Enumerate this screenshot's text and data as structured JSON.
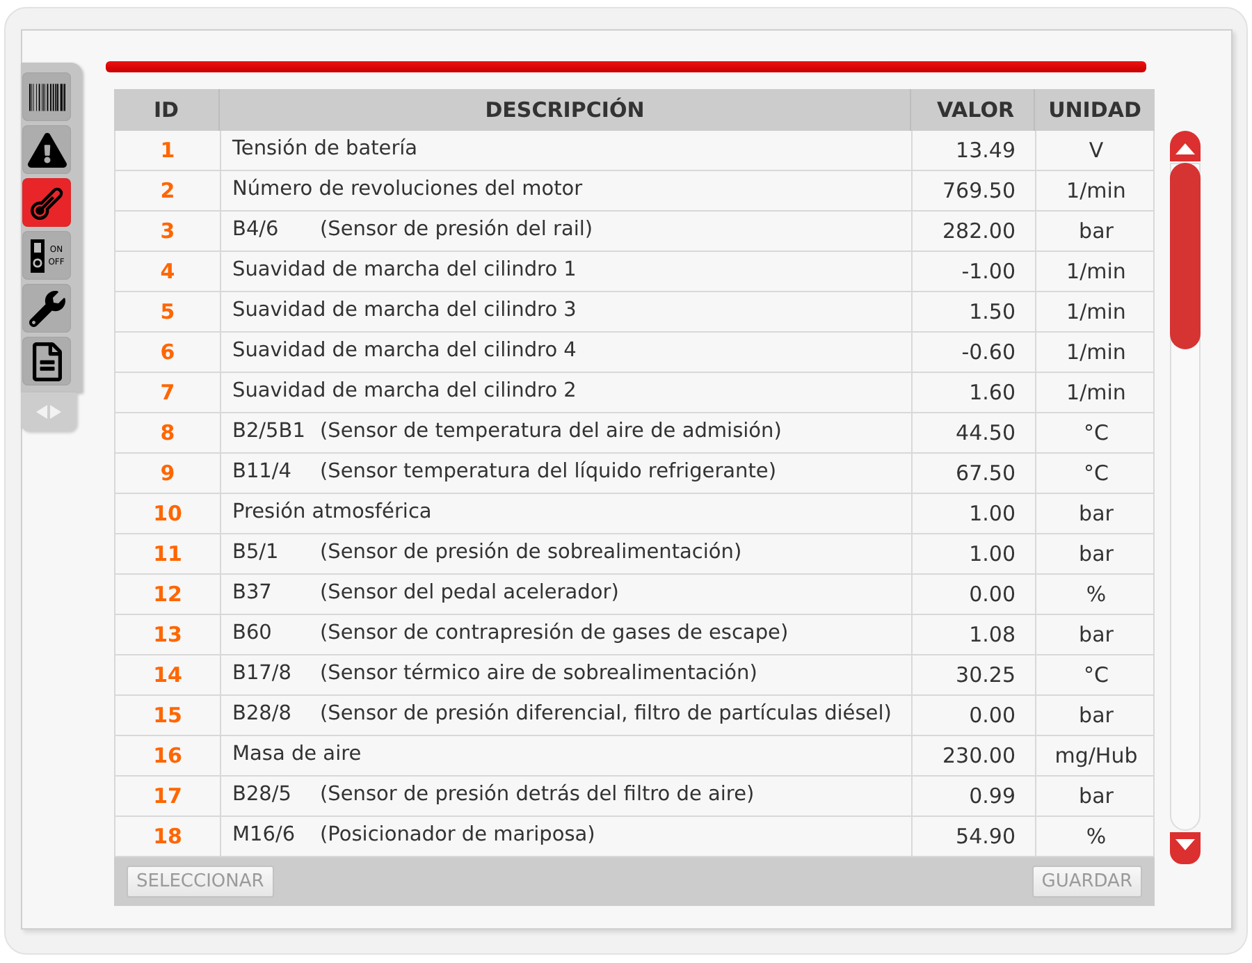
{
  "sidebar": {
    "items": [
      {
        "selected": false
      },
      {
        "selected": false
      },
      {
        "selected": true
      },
      {
        "selected": false,
        "labels": [
          "ON",
          "OFF"
        ]
      },
      {
        "selected": false
      },
      {
        "selected": false
      }
    ]
  },
  "table": {
    "columns": [
      "ID",
      "DESCRIPCIÓN",
      "VALOR",
      "UNIDAD"
    ],
    "rows": [
      {
        "id": "1",
        "description": "Tensión de batería",
        "value": "13.49",
        "unit": "V"
      },
      {
        "id": "2",
        "description": "Número de revoluciones del motor",
        "value": "769.50",
        "unit": "1/min"
      },
      {
        "id": "3",
        "code": "B4/6",
        "description": "(Sensor de presión del rail)",
        "value": "282.00",
        "unit": "bar"
      },
      {
        "id": "4",
        "description": "Suavidad de marcha del cilindro 1",
        "value": "-1.00",
        "unit": "1/min"
      },
      {
        "id": "5",
        "description": "Suavidad de marcha del cilindro 3",
        "value": "1.50",
        "unit": "1/min"
      },
      {
        "id": "6",
        "description": "Suavidad de marcha del cilindro 4",
        "value": "-0.60",
        "unit": "1/min"
      },
      {
        "id": "7",
        "description": "Suavidad de marcha del cilindro 2",
        "value": "1.60",
        "unit": "1/min"
      },
      {
        "id": "8",
        "code": "B2/5B1",
        "description": "(Sensor de temperatura del aire de admisión)",
        "value": "44.50",
        "unit": "°C"
      },
      {
        "id": "9",
        "code": "B11/4",
        "description": "(Sensor temperatura del líquido refrigerante)",
        "value": "67.50",
        "unit": "°C"
      },
      {
        "id": "10",
        "description": "Presión atmosférica",
        "value": "1.00",
        "unit": "bar"
      },
      {
        "id": "11",
        "code": "B5/1",
        "description": "(Sensor de presión de sobrealimentación)",
        "value": "1.00",
        "unit": "bar"
      },
      {
        "id": "12",
        "code": "B37",
        "description": "(Sensor del pedal acelerador)",
        "value": "0.00",
        "unit": "%"
      },
      {
        "id": "13",
        "code": "B60",
        "description": "(Sensor de contrapresión de gases de escape)",
        "value": "1.08",
        "unit": "bar"
      },
      {
        "id": "14",
        "code": "B17/8",
        "description": "(Sensor térmico aire de sobrealimentación)",
        "value": "30.25",
        "unit": "°C"
      },
      {
        "id": "15",
        "code": "B28/8",
        "description": "(Sensor de presión diferencial, filtro de partículas diésel)",
        "value": "0.00",
        "unit": "bar"
      },
      {
        "id": "16",
        "description": "Masa de aire",
        "value": "230.00",
        "unit": "mg/Hub"
      },
      {
        "id": "17",
        "code": "B28/5",
        "description": "(Sensor de presión detrás del filtro de aire)",
        "value": "0.99",
        "unit": "bar"
      },
      {
        "id": "18",
        "code": "M16/6",
        "description": "(Posicionador de mariposa)",
        "value": "54.90",
        "unit": "%"
      }
    ]
  },
  "buttons": [
    {
      "label": "SELECCIONAR",
      "disabled": true
    },
    {
      "label": "GUARDAR",
      "disabled": true
    }
  ]
}
